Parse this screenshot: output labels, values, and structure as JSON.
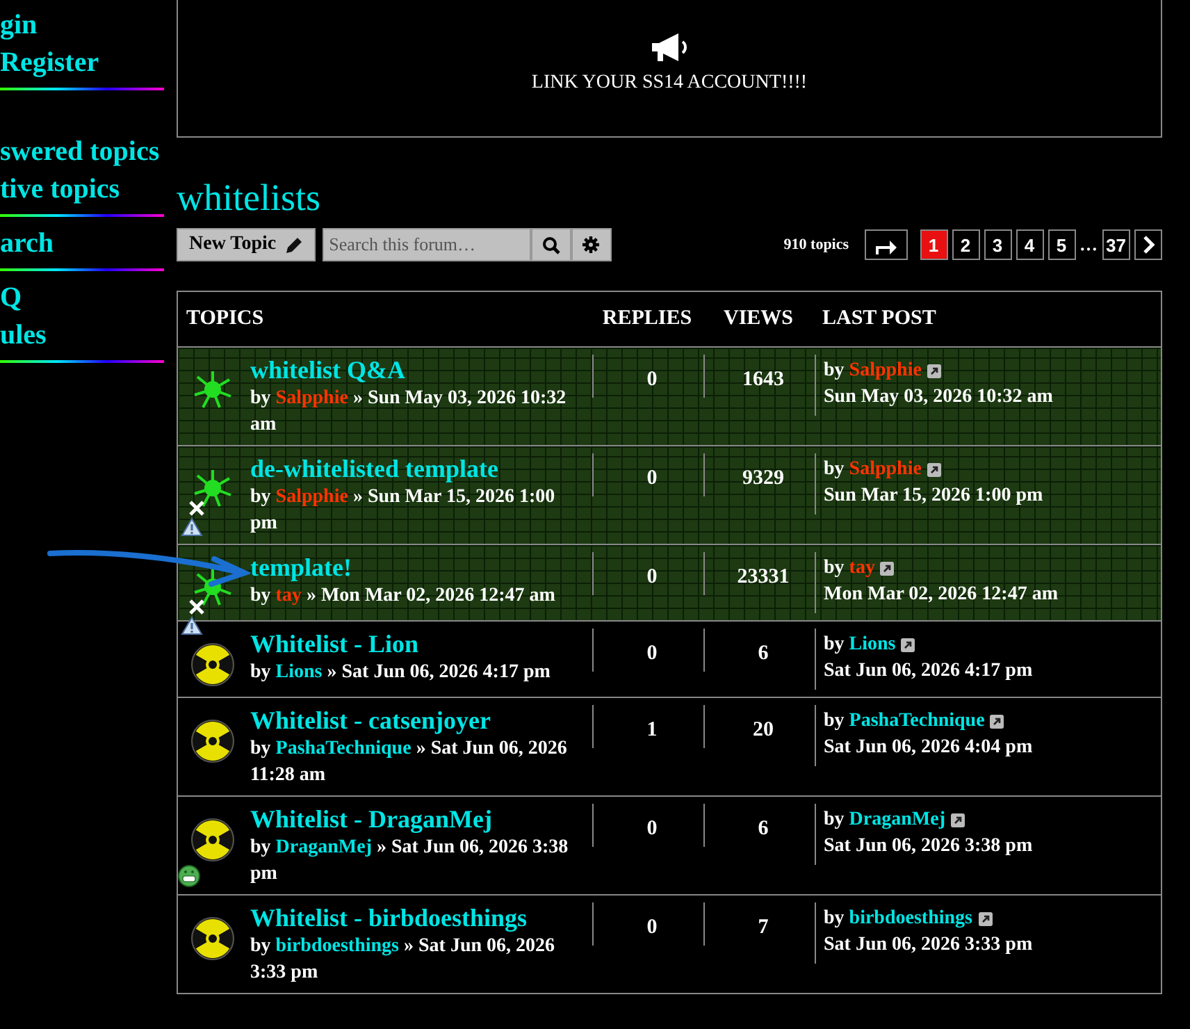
{
  "sidebar": {
    "groups": [
      {
        "items": [
          "gin",
          "Register"
        ]
      },
      {
        "items": [
          "swered topics",
          "tive topics"
        ]
      },
      {
        "items": [
          "arch"
        ]
      },
      {
        "items": [
          "Q",
          "ules"
        ]
      }
    ]
  },
  "notice": {
    "text": "LINK YOUR SS14 ACCOUNT!!!!"
  },
  "forum": {
    "title": "whitelists"
  },
  "toolbar": {
    "new_topic": "New Topic",
    "search": {
      "placeholder": "Search this forum…"
    }
  },
  "pagination": {
    "count": "910 topics",
    "pages": [
      {
        "label": "1",
        "selected": true
      },
      {
        "label": "2",
        "selected": false
      },
      {
        "label": "3",
        "selected": false
      },
      {
        "label": "4",
        "selected": false
      },
      {
        "label": "5",
        "selected": false
      },
      {
        "label": "…",
        "kind": "ellipsis"
      },
      {
        "label": "37",
        "selected": false
      }
    ]
  },
  "table": {
    "columns": [
      "TOPICS",
      "REPLIES",
      "VIEWS",
      "LAST POST"
    ],
    "rows": [
      {
        "kind": "sticky",
        "locked": false,
        "reported": false,
        "smiley": false,
        "title": "whitelist Q&A",
        "by": "by",
        "author": {
          "name": "Salpphie",
          "color": "#ff3300"
        },
        "date": "» Sun May 03, 2026 10:32 am",
        "replies": "0",
        "views": "1643",
        "last_by": "by",
        "last_author": {
          "name": "Salpphie",
          "color": "#ff3300"
        },
        "last_date": "Sun May 03, 2026 10:32 am"
      },
      {
        "kind": "sticky",
        "locked": true,
        "reported": true,
        "smiley": false,
        "title": "de-whitelisted template",
        "by": "by",
        "author": {
          "name": "Salpphie",
          "color": "#ff3300"
        },
        "date": "» Sun Mar 15, 2026 1:00 pm",
        "replies": "0",
        "views": "9329",
        "last_by": "by",
        "last_author": {
          "name": "Salpphie",
          "color": "#ff3300"
        },
        "last_date": "Sun Mar 15, 2026 1:00 pm"
      },
      {
        "kind": "sticky",
        "locked": true,
        "reported": true,
        "smiley": false,
        "title": "template!",
        "by": "by",
        "author": {
          "name": "tay",
          "color": "#ff3300"
        },
        "date": "» Mon Mar 02, 2026 12:47 am",
        "replies": "0",
        "views": "23331",
        "last_by": "by",
        "last_author": {
          "name": "tay",
          "color": "#ff3300"
        },
        "last_date": "Mon Mar 02, 2026 12:47 am"
      },
      {
        "kind": "topic",
        "locked": false,
        "reported": false,
        "smiley": false,
        "title": "Whitelist - Lion",
        "by": "by",
        "author": {
          "name": "Lions",
          "color": "#00e5e5"
        },
        "date": "» Sat Jun 06, 2026 4:17 pm",
        "replies": "0",
        "views": "6",
        "last_by": "by",
        "last_author": {
          "name": "Lions",
          "color": "#00e5e5"
        },
        "last_date": "Sat Jun 06, 2026 4:17 pm"
      },
      {
        "kind": "topic",
        "locked": false,
        "reported": false,
        "smiley": false,
        "title": "Whitelist - catsenjoyer",
        "by": "by",
        "author": {
          "name": "PashaTechnique",
          "color": "#00e5e5"
        },
        "date": "» Sat Jun 06, 2026 11:28 am",
        "replies": "1",
        "views": "20",
        "last_by": "by",
        "last_author": {
          "name": "PashaTechnique",
          "color": "#00e5e5"
        },
        "last_date": "Sat Jun 06, 2026 4:04 pm"
      },
      {
        "kind": "topic",
        "locked": false,
        "reported": false,
        "smiley": true,
        "title": "Whitelist - DraganMej",
        "by": "by",
        "author": {
          "name": "DraganMej",
          "color": "#00e5e5"
        },
        "date": "» Sat Jun 06, 2026 3:38 pm",
        "replies": "0",
        "views": "6",
        "last_by": "by",
        "last_author": {
          "name": "DraganMej",
          "color": "#00e5e5"
        },
        "last_date": "Sat Jun 06, 2026 3:38 pm"
      },
      {
        "kind": "topic",
        "locked": false,
        "reported": false,
        "smiley": false,
        "title": "Whitelist - birbdoesthings",
        "by": "by",
        "author": {
          "name": "birbdoesthings",
          "color": "#00e5e5"
        },
        "date": "» Sat Jun 06, 2026 3:33 pm",
        "replies": "0",
        "views": "7",
        "last_by": "by",
        "last_author": {
          "name": "birbdoesthings",
          "color": "#00e5e5"
        },
        "last_date": "Sat Jun 06, 2026 3:33 pm"
      }
    ]
  }
}
